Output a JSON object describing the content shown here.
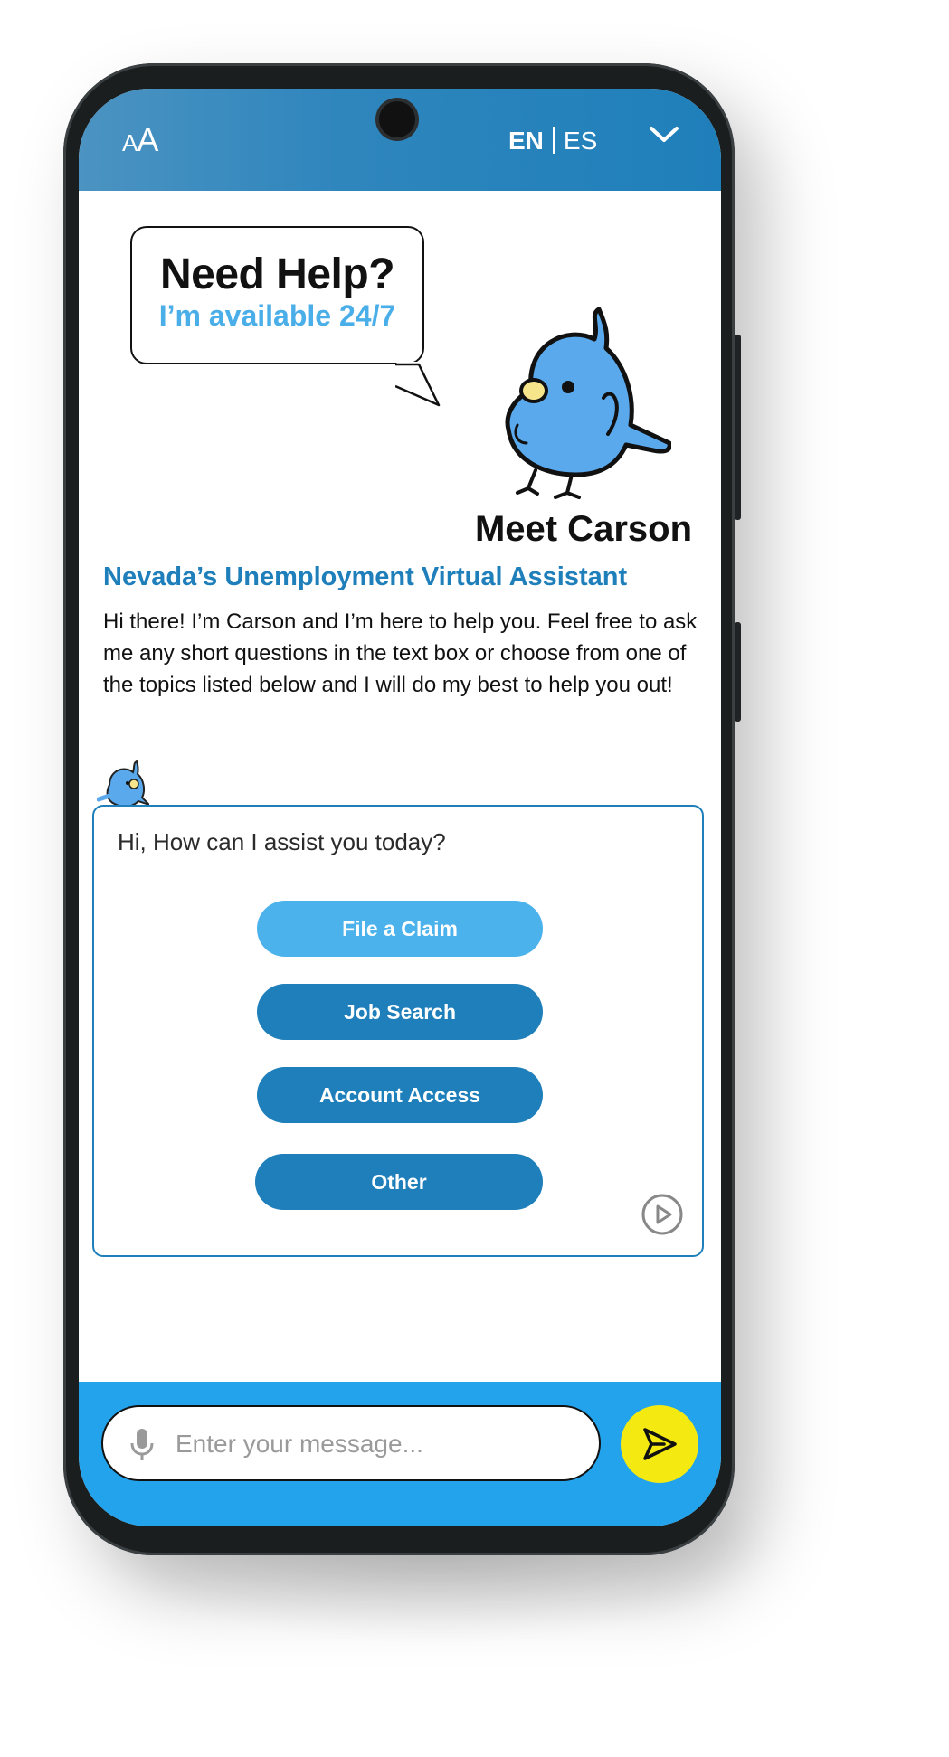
{
  "header": {
    "font_size_small": "A",
    "font_size_large": "A",
    "lang_en": "EN",
    "lang_es": "ES",
    "menu_icon": "chevron-down-icon"
  },
  "hero": {
    "bubble_title": "Need Help?",
    "bubble_subtitle": "I’m available 24/7",
    "mascot_icon": "bluebird-mascot",
    "meet_title": "Meet Carson",
    "subtitle": "Nevada’s Unemployment Virtual Assistant",
    "intro": "Hi there! I’m Carson and I’m here to help you.  Feel free to ask me any short questions in the text box or choose from one of the topics listed below and I will do my best to help you out!"
  },
  "chat": {
    "greeting": "Hi, How can I assist you today?",
    "options": [
      {
        "label": "File a Claim"
      },
      {
        "label": "Job Search"
      },
      {
        "label": "Account Access"
      },
      {
        "label": "Other"
      }
    ],
    "play_icon": "play-circle-icon"
  },
  "composer": {
    "placeholder": "Enter your message...",
    "mic_icon": "microphone-icon",
    "send_icon": "send-icon"
  },
  "colors": {
    "primary": "#1f7fba",
    "light_blue": "#4cb2ec",
    "composer_bar": "#22a3ec",
    "send_button": "#f4ea11"
  }
}
